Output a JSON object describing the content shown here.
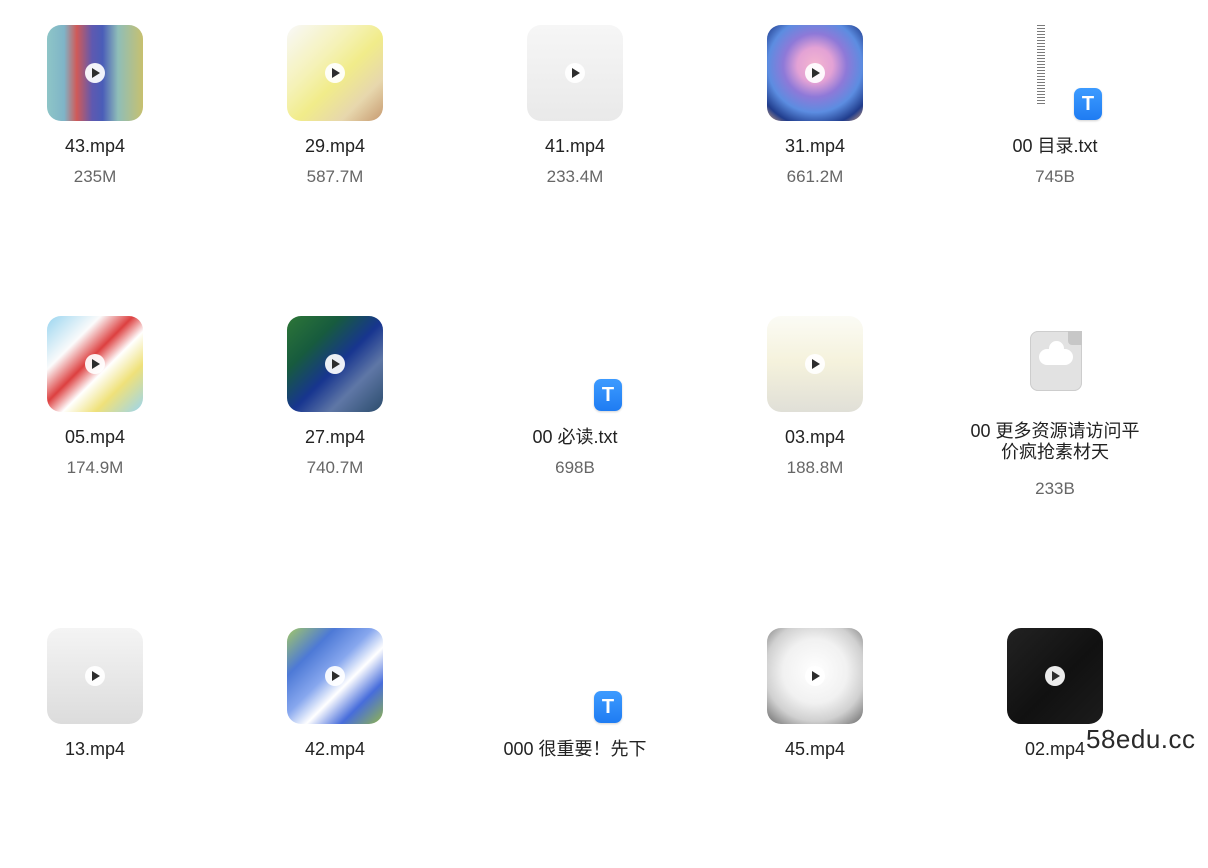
{
  "files": [
    {
      "id": "43",
      "name": "43.mp4",
      "size": "235M",
      "kind": "video",
      "thumb": "linear-gradient(90deg,#8ec5c7 0%,#7fb4c7 18%,#d05a58 31%,#5f59b0 47%,#4a5db8 58%,#8fbeb8 74%,#c7c06f 100%)"
    },
    {
      "id": "29",
      "name": "29.mp4",
      "size": "587.7M",
      "kind": "video",
      "thumb": "linear-gradient(135deg,#f8f8f8 0%,#f5f2b8 35%,#f1ec8a 55%,#e7d7ad 78%,#c79a70 100%)"
    },
    {
      "id": "41",
      "name": "41.mp4",
      "size": "233.4M",
      "kind": "video",
      "thumb": "linear-gradient(180deg,#f6f6f6 0%,#e9e9e9 100%)"
    },
    {
      "id": "31",
      "name": "31.mp4",
      "size": "661.2M",
      "kind": "video",
      "thumb": "radial-gradient(circle at 50% 42%,#f4b6d0 0%,#e3a2d5 24%,#8e79d8 43%,#5c8de1 64%,#203c8c 84%,#d3a37e 100%)"
    },
    {
      "id": "00mulu",
      "name": "00 目录.txt",
      "size": "745B",
      "kind": "txt-page"
    },
    {
      "id": "05",
      "name": "05.mp4",
      "size": "174.9M",
      "kind": "video",
      "thumb": "linear-gradient(135deg,#9ad5f0 0%,#fbfbfb 28%,#dd4040 45%,#ffffff 58%,#efe17a 75%,#9ad5f0 100%)"
    },
    {
      "id": "27",
      "name": "27.mp4",
      "size": "740.7M",
      "kind": "video",
      "thumb": "linear-gradient(135deg,#2d7637 0%,#175b3e 28%,#17358f 52%,#5f77a6 72%,#2b4c6c 100%)"
    },
    {
      "id": "00bidu",
      "name": "00 必读.txt",
      "size": "698B",
      "kind": "txt"
    },
    {
      "id": "03",
      "name": "03.mp4",
      "size": "188.8M",
      "kind": "video",
      "thumb": "linear-gradient(180deg,#fbfbf5 0%,#f5f2dc 48%,#e0dfd7 100%)"
    },
    {
      "id": "00more",
      "name": "00 更多资源请访问平价疯抢素材天",
      "size": "233B",
      "kind": "cloud"
    },
    {
      "id": "13",
      "name": "13.mp4",
      "size": "",
      "kind": "video",
      "thumb": "linear-gradient(180deg,#f4f4f4 0%,#dcdcdc 100%)"
    },
    {
      "id": "42",
      "name": "42.mp4",
      "size": "",
      "kind": "video",
      "thumb": "linear-gradient(135deg,#a2c867 0%,#4d79d6 25%,#87a7ee 45%,#ffffff 60%,#476ddb 78%,#92b64c 100%)"
    },
    {
      "id": "000",
      "name": "000 很重要！先下",
      "size": "",
      "kind": "txt"
    },
    {
      "id": "45",
      "name": "45.mp4",
      "size": "",
      "kind": "video",
      "thumb": "radial-gradient(circle at 50% 45%,#ffffff 0%,#f1f1f1 45%,#d0d0d0 70%,#6a6a6a 100%)"
    },
    {
      "id": "02",
      "name": "02.mp4",
      "size": "",
      "kind": "video",
      "thumb": "linear-gradient(135deg,#222 0%,#111 55%,#1c1c1c 100%)"
    }
  ],
  "footer": {
    "watermark": "58edu.cc"
  }
}
